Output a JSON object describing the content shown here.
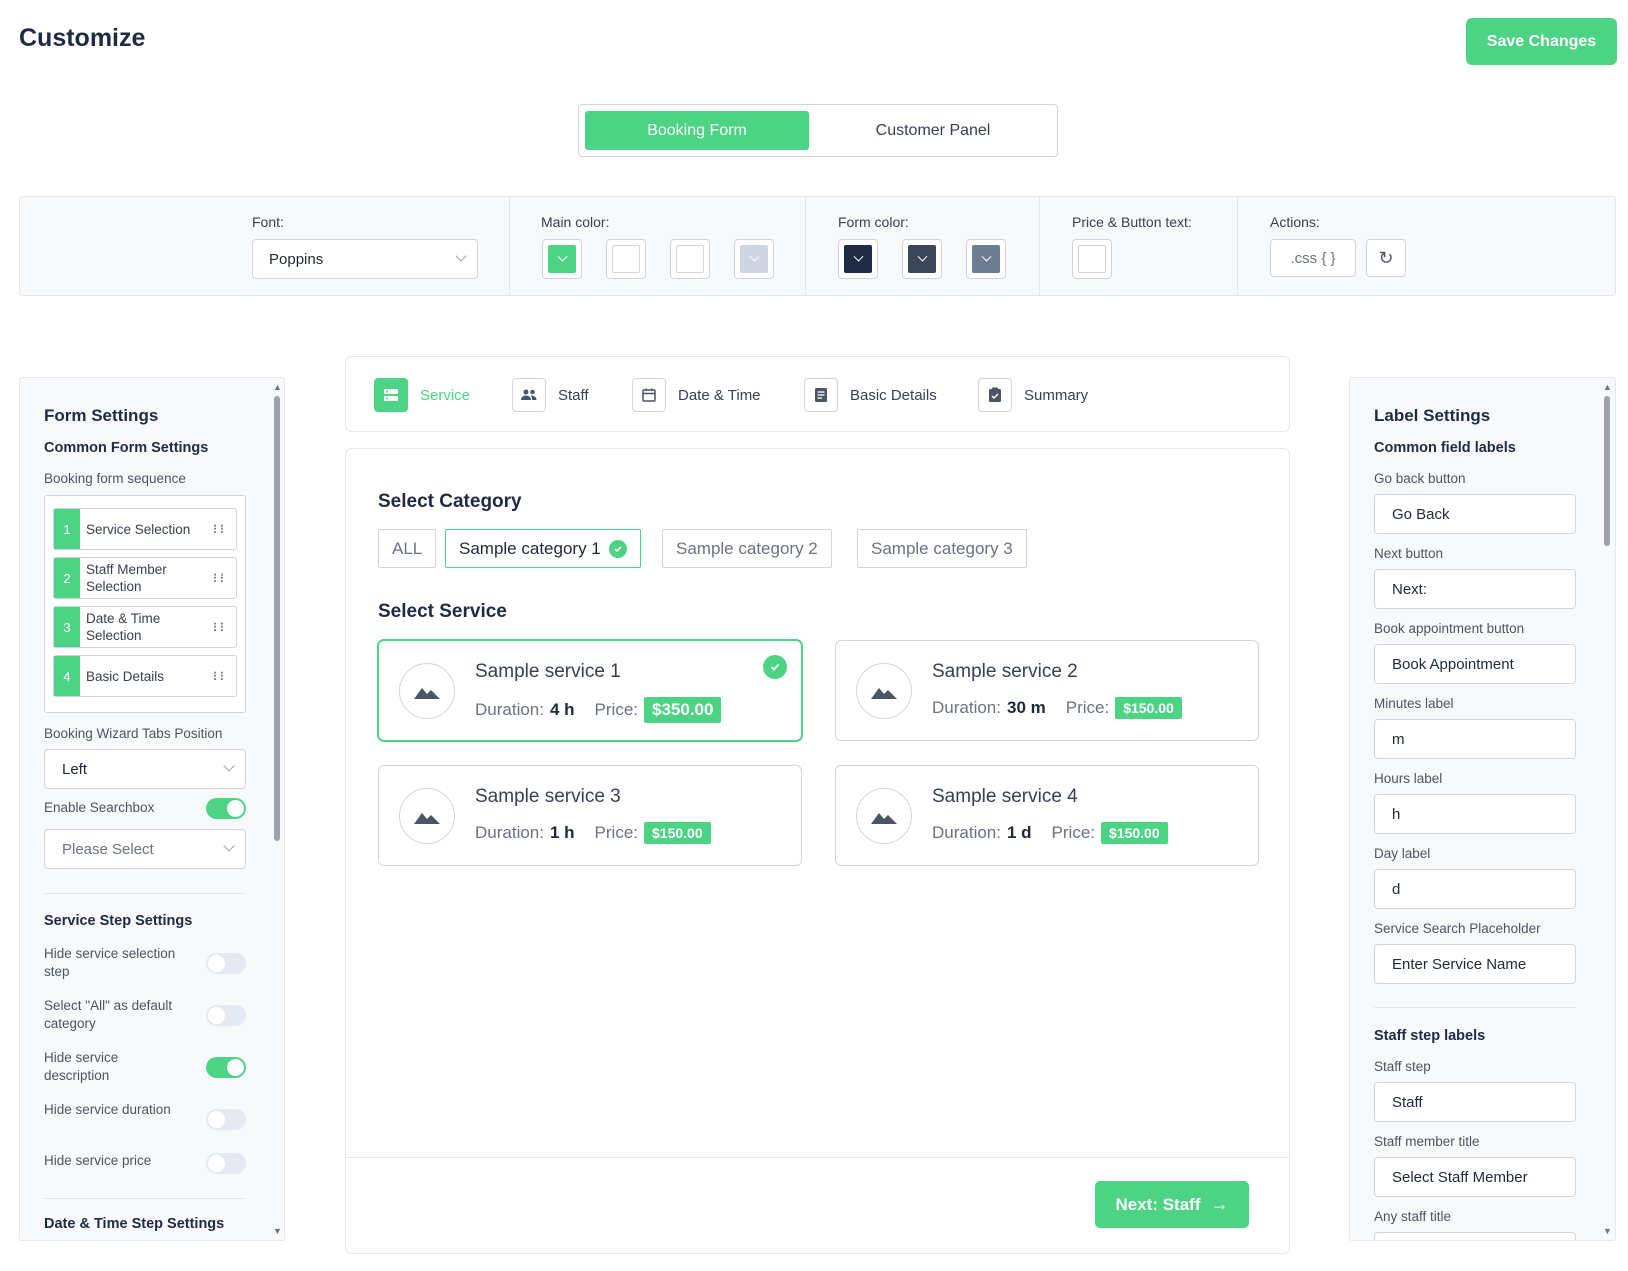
{
  "header": {
    "title": "Customize",
    "save_label": "Save Changes"
  },
  "mode_tabs": [
    {
      "label": "Booking Form",
      "active": true
    },
    {
      "label": "Customer Panel",
      "active": false
    }
  ],
  "toolbar": {
    "font_label": "Font:",
    "font_value": "Poppins",
    "main_color_label": "Main color:",
    "main_colors": [
      "#4cd484",
      "#ffffff",
      "#ffffff",
      "#cfd5e3"
    ],
    "form_color_label": "Form color:",
    "form_colors": [
      "#1f2a44",
      "#3b4658",
      "#6f7d92"
    ],
    "price_label": "Price & Button text:",
    "price_color": "#ffffff",
    "actions_label": "Actions:",
    "css_label": ".css { }"
  },
  "left_panel": {
    "title": "Form Settings",
    "common_title": "Common Form Settings",
    "sequence_label": "Booking form sequence",
    "sequence": [
      {
        "num": "1",
        "label": "Service Selection"
      },
      {
        "num": "2",
        "label": "Staff Member Selection"
      },
      {
        "num": "3",
        "label": "Date & Time Selection"
      },
      {
        "num": "4",
        "label": "Basic Details"
      }
    ],
    "tabs_position_label": "Booking Wizard Tabs Position",
    "tabs_position_value": "Left",
    "searchbox_label": "Enable Searchbox",
    "searchbox_on": true,
    "searchbox_placeholder": "Please Select",
    "service_step_title": "Service Step Settings",
    "service_toggles": [
      {
        "label": "Hide service selection step",
        "on": false
      },
      {
        "label": "Select \"All\" as default category",
        "on": false
      },
      {
        "label": "Hide service description",
        "on": true
      },
      {
        "label": "Hide service duration",
        "on": false
      },
      {
        "label": "Hide service price",
        "on": false
      }
    ],
    "datetime_title": "Date & Time Step Settings"
  },
  "wizard_tabs": [
    {
      "label": "Service",
      "icon": "service-icon",
      "active": true
    },
    {
      "label": "Staff",
      "icon": "staff-icon",
      "active": false
    },
    {
      "label": "Date & Time",
      "icon": "calendar-icon",
      "active": false
    },
    {
      "label": "Basic Details",
      "icon": "details-icon",
      "active": false
    },
    {
      "label": "Summary",
      "icon": "summary-icon",
      "active": false
    }
  ],
  "main": {
    "category_title": "Select Category",
    "categories": [
      {
        "label": "ALL",
        "active": false
      },
      {
        "label": "Sample category 1",
        "active": true
      },
      {
        "label": "Sample category 2",
        "active": false
      },
      {
        "label": "Sample category 3",
        "active": false
      }
    ],
    "service_title": "Select Service",
    "duration_label": "Duration:",
    "price_label": "Price:",
    "services": [
      {
        "name": "Sample service 1",
        "duration": "4 h",
        "price": "$350.00",
        "selected": true
      },
      {
        "name": "Sample service 2",
        "duration": "30 m",
        "price": "$150.00",
        "selected": false
      },
      {
        "name": "Sample service 3",
        "duration": "1 h",
        "price": "$150.00",
        "selected": false
      },
      {
        "name": "Sample service 4",
        "duration": "1 d",
        "price": "$150.00",
        "selected": false
      }
    ],
    "next_label": "Next: Staff"
  },
  "right_panel": {
    "title": "Label Settings",
    "common_title": "Common field labels",
    "fields": [
      {
        "label": "Go back button",
        "value": "Go Back"
      },
      {
        "label": "Next button",
        "value": "Next:"
      },
      {
        "label": "Book appointment button",
        "value": "Book Appointment"
      },
      {
        "label": "Minutes label",
        "value": "m"
      },
      {
        "label": "Hours label",
        "value": "h"
      },
      {
        "label": "Day label",
        "value": "d"
      },
      {
        "label": "Service Search Placeholder",
        "value": "Enter Service Name"
      }
    ],
    "staff_title": "Staff step labels",
    "staff_fields": [
      {
        "label": "Staff step",
        "value": "Staff"
      },
      {
        "label": "Staff member title",
        "value": "Select Staff Member"
      },
      {
        "label": "Any staff title",
        "value": ""
      }
    ]
  }
}
